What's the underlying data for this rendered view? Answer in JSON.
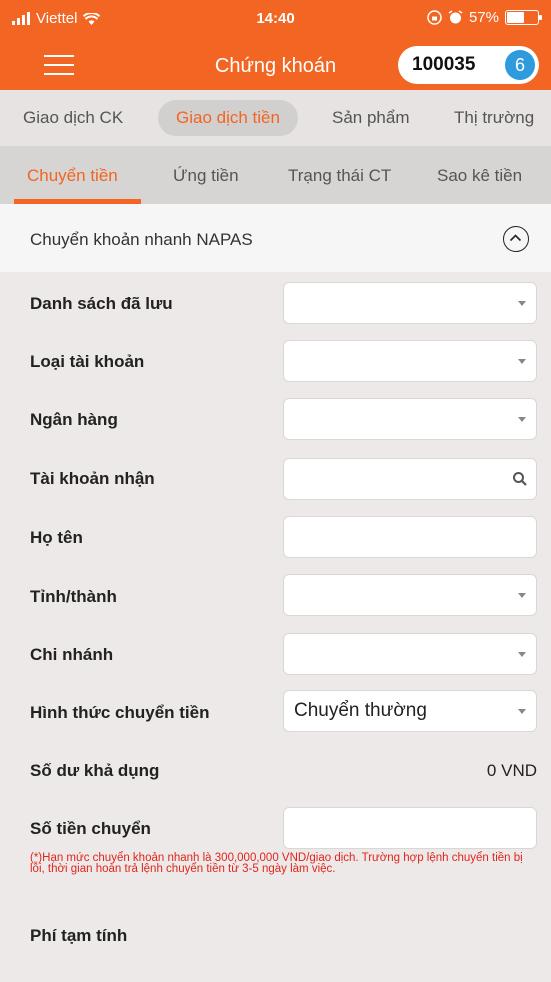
{
  "status_bar": {
    "carrier": "Viettel",
    "time": "14:40",
    "battery": "57%",
    "battery_level": 0.57
  },
  "header": {
    "title": "Chứng khoán",
    "account_number": "100035",
    "account_badge": "6"
  },
  "main_tabs": [
    {
      "label": "Giao dịch CK",
      "active": false
    },
    {
      "label": "Giao dịch tiền",
      "active": true
    },
    {
      "label": "Sản phẩm",
      "active": false
    },
    {
      "label": "Thị trường",
      "active": false
    }
  ],
  "sub_tabs": [
    {
      "label": "Chuyển tiền",
      "active": true
    },
    {
      "label": "Ứng tiền",
      "active": false
    },
    {
      "label": "Trạng thái CT",
      "active": false
    },
    {
      "label": "Sao kê tiền",
      "active": false
    }
  ],
  "section": {
    "title": "Chuyển khoản nhanh NAPAS"
  },
  "form": {
    "saved_list": {
      "label": "Danh sách đã lưu",
      "value": ""
    },
    "account_type": {
      "label": "Loại tài khoản",
      "value": ""
    },
    "bank": {
      "label": "Ngân hàng",
      "value": ""
    },
    "receiver_account": {
      "label": "Tài khoản nhận",
      "value": ""
    },
    "full_name": {
      "label": "Họ tên",
      "value": ""
    },
    "province": {
      "label": "Tỉnh/thành",
      "value": ""
    },
    "branch": {
      "label": "Chi nhánh",
      "value": ""
    },
    "transfer_method": {
      "label": "Hình thức chuyển tiền",
      "value": "Chuyển thường"
    },
    "available_balance": {
      "label": "Số dư khả dụng",
      "value": "0 VND"
    },
    "transfer_amount": {
      "label": "Số tiền chuyển",
      "value": ""
    },
    "note": "(*)Hạn mức chuyển khoản nhanh là 300,000,000 VND/giao dịch. Trường hợp lệnh chuyển tiền bị lỗi, thời gian hoàn trả lệnh chuyển tiền từ 3-5 ngày làm việc.",
    "estimated_fee": {
      "label": "Phí tạm tính"
    }
  },
  "colors": {
    "brand_orange": "#f26522",
    "badge_blue": "#2d9bde",
    "note_red": "#e0261d"
  }
}
